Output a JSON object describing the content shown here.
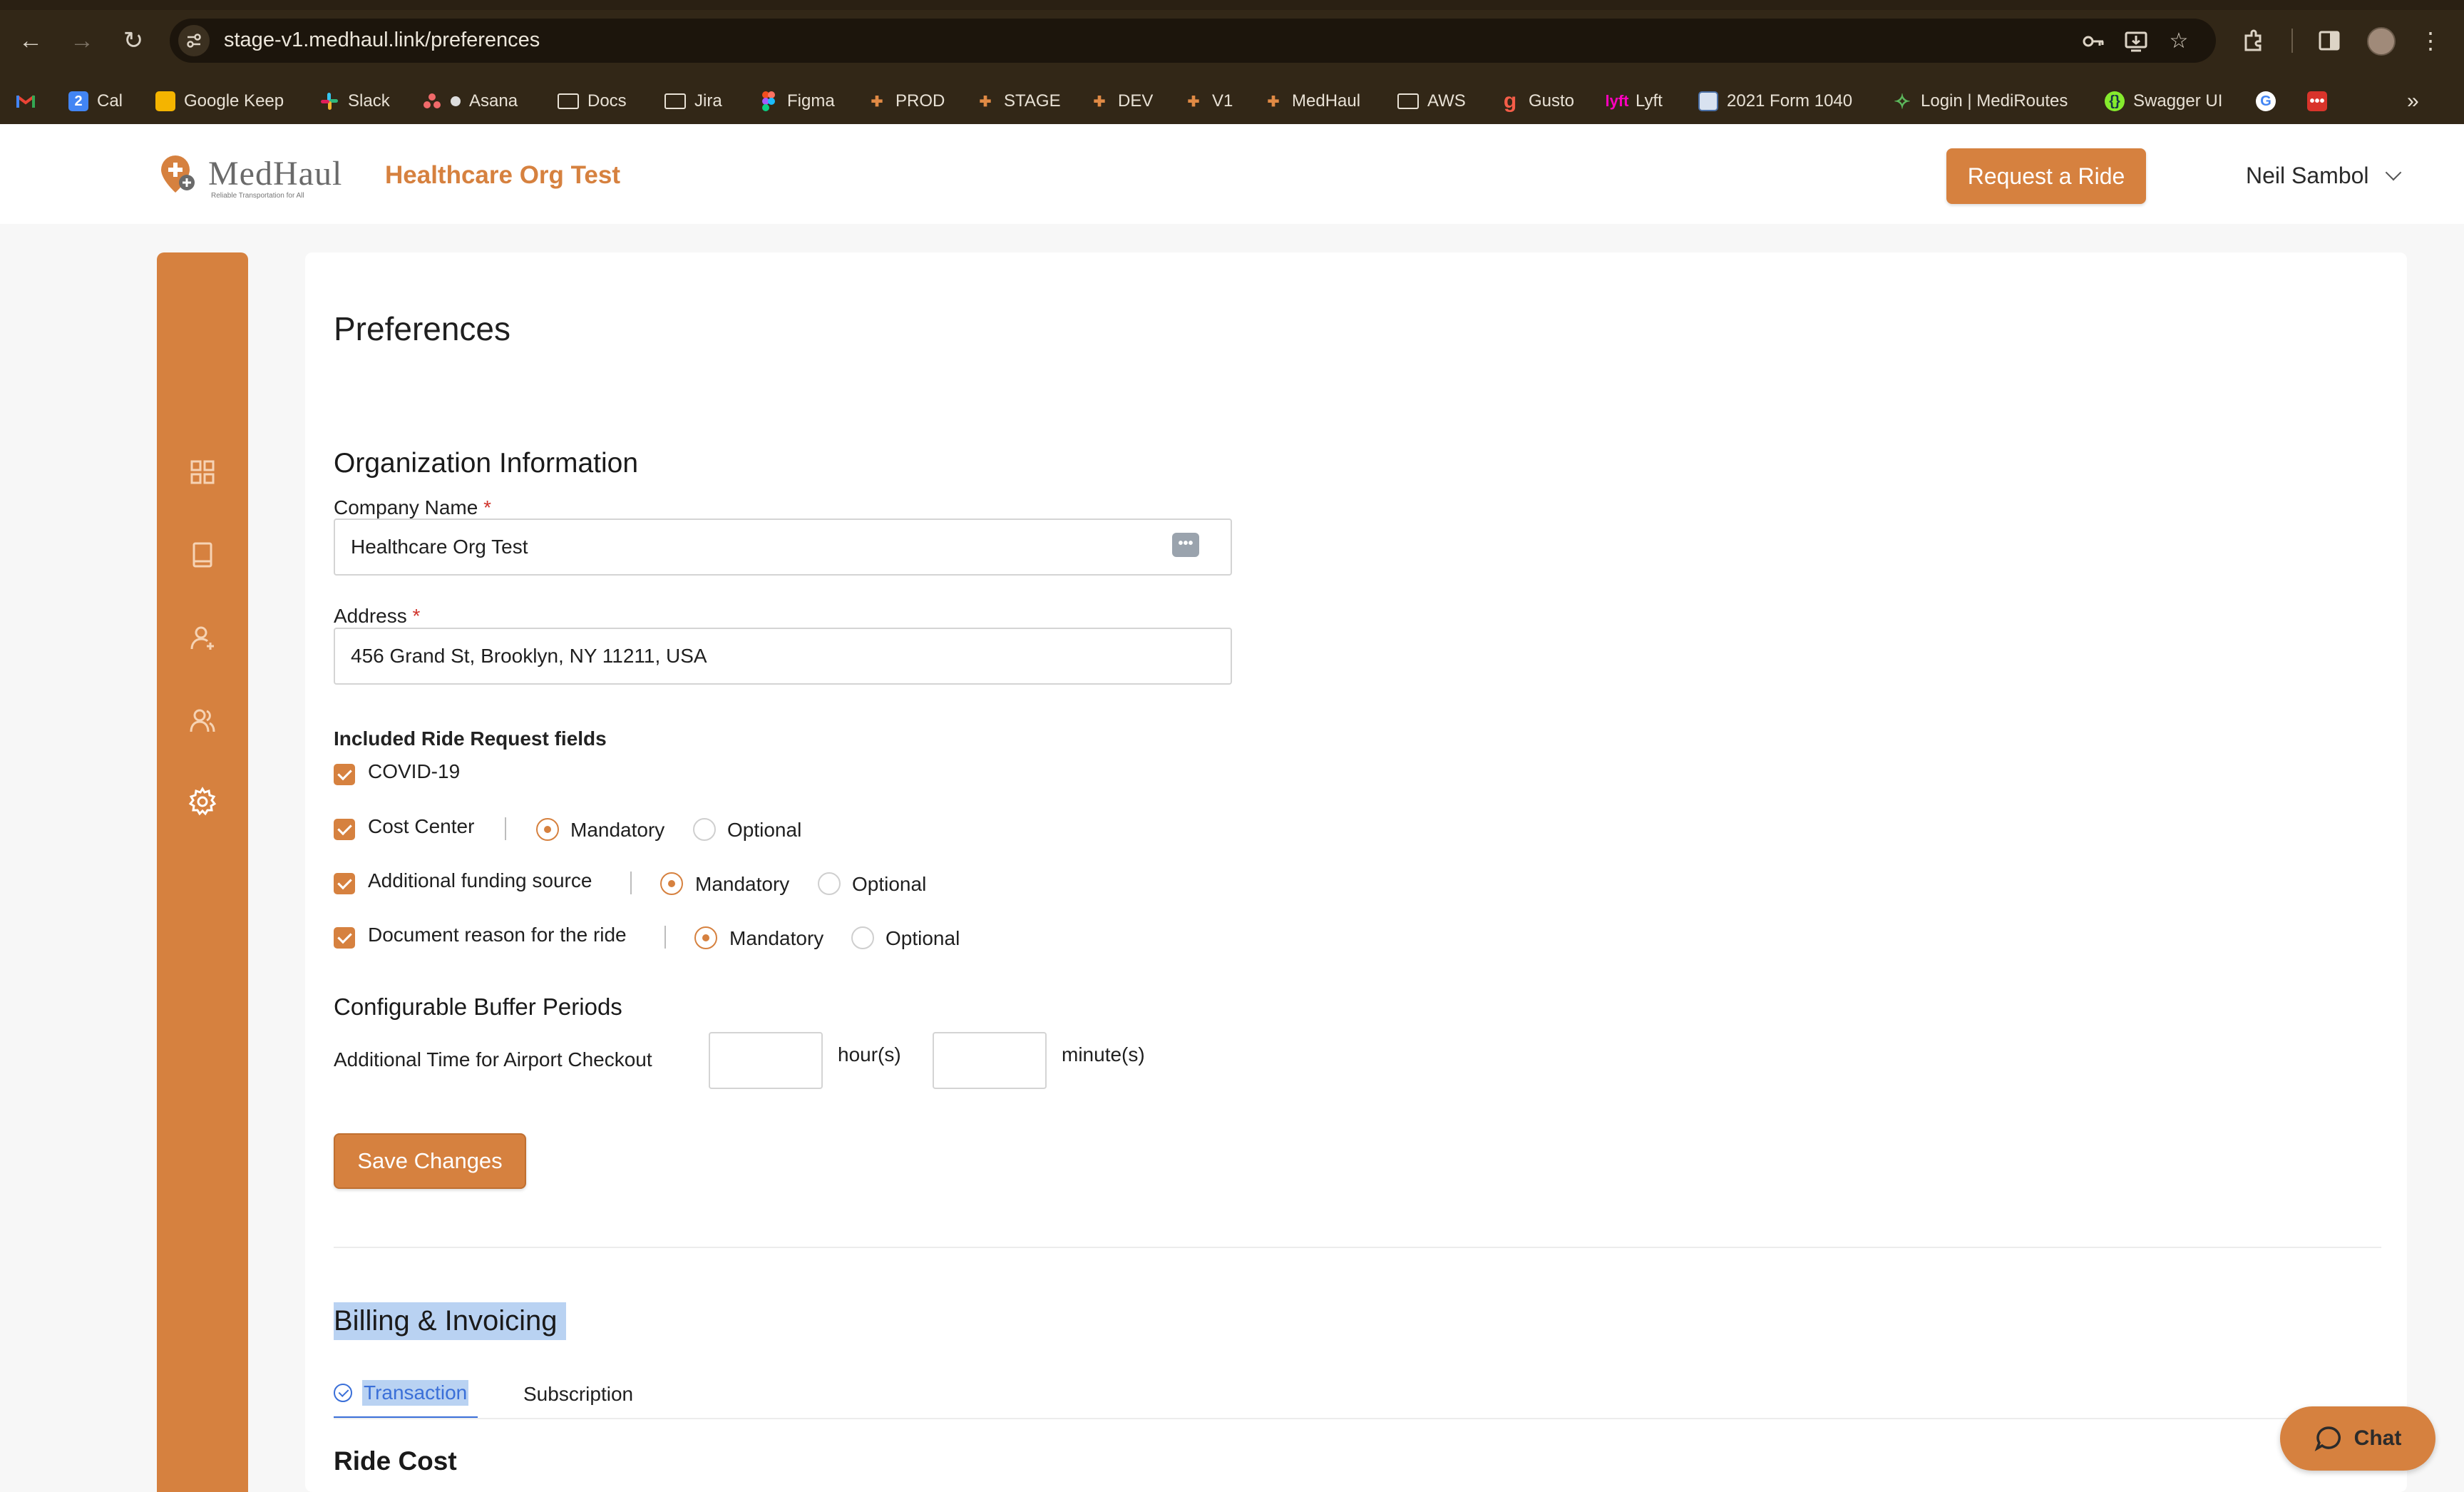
{
  "browser": {
    "url": "stage-v1.medhaul.link/preferences",
    "bookmarks": [
      {
        "label": "",
        "icon": "gmail-icon"
      },
      {
        "label": "Cal",
        "icon": "calendar-icon"
      },
      {
        "label": "Google Keep",
        "icon": "keep-icon"
      },
      {
        "label": "Slack",
        "icon": "slack-icon"
      },
      {
        "label": "Asana",
        "icon": "asana-icon"
      },
      {
        "label": "Docs",
        "icon": "folder-icon"
      },
      {
        "label": "Jira",
        "icon": "folder-icon"
      },
      {
        "label": "Figma",
        "icon": "figma-icon"
      },
      {
        "label": "PROD",
        "icon": "medhaul-icon"
      },
      {
        "label": "STAGE",
        "icon": "medhaul-icon"
      },
      {
        "label": "DEV",
        "icon": "medhaul-icon"
      },
      {
        "label": "V1",
        "icon": "medhaul-icon"
      },
      {
        "label": "MedHaul",
        "icon": "medhaul-icon"
      },
      {
        "label": "AWS",
        "icon": "folder-icon"
      },
      {
        "label": "Gusto",
        "icon": "gusto-icon"
      },
      {
        "label": "Lyft",
        "icon": "lyft-icon"
      },
      {
        "label": "2021 Form 1040",
        "icon": "form-icon"
      },
      {
        "label": "Login | MediRoutes",
        "icon": "mediroutes-icon"
      },
      {
        "label": "Swagger UI",
        "icon": "swagger-icon"
      }
    ]
  },
  "header": {
    "logo_text": "MedHaul",
    "logo_tagline": "Reliable Transportation for All",
    "org_name": "Healthcare Org Test",
    "request_ride_label": "Request a Ride",
    "user_name": "Neil Sambol"
  },
  "page": {
    "title": "Preferences",
    "org_info": {
      "title": "Organization Information",
      "company_label": "Company Name",
      "company_value": "Healthcare Org Test",
      "address_label": "Address",
      "address_value": "456 Grand St, Brooklyn, NY 11211, USA",
      "required_mark": "*"
    },
    "ride_fields": {
      "title": "Included Ride Request fields",
      "items": [
        {
          "label": "COVID-19",
          "checked": true
        },
        {
          "label": "Cost Center",
          "checked": true,
          "mode": "Mandatory"
        },
        {
          "label": "Additional funding source",
          "checked": true,
          "mode": "Mandatory"
        },
        {
          "label": "Document reason for the ride",
          "checked": true,
          "mode": "Mandatory"
        }
      ],
      "mandatory_label": "Mandatory",
      "optional_label": "Optional"
    },
    "buffer": {
      "title": "Configurable Buffer Periods",
      "airport_label": "Additional Time for Airport Checkout",
      "hours_value": "",
      "hours_unit": "hour(s)",
      "minutes_value": "",
      "minutes_unit": "minute(s)"
    },
    "save_label": "Save Changes",
    "billing": {
      "title": "Billing & Invoicing",
      "tabs": [
        {
          "label": "Transaction",
          "active": true
        },
        {
          "label": "Subscription",
          "active": false
        }
      ],
      "ride_cost_title": "Ride Cost"
    }
  },
  "chat": {
    "label": "Chat"
  },
  "colors": {
    "brand": "#d6813f",
    "chrome": "#322717",
    "active_tab": "#3a6fd8",
    "selection": "#b9d2f2"
  }
}
